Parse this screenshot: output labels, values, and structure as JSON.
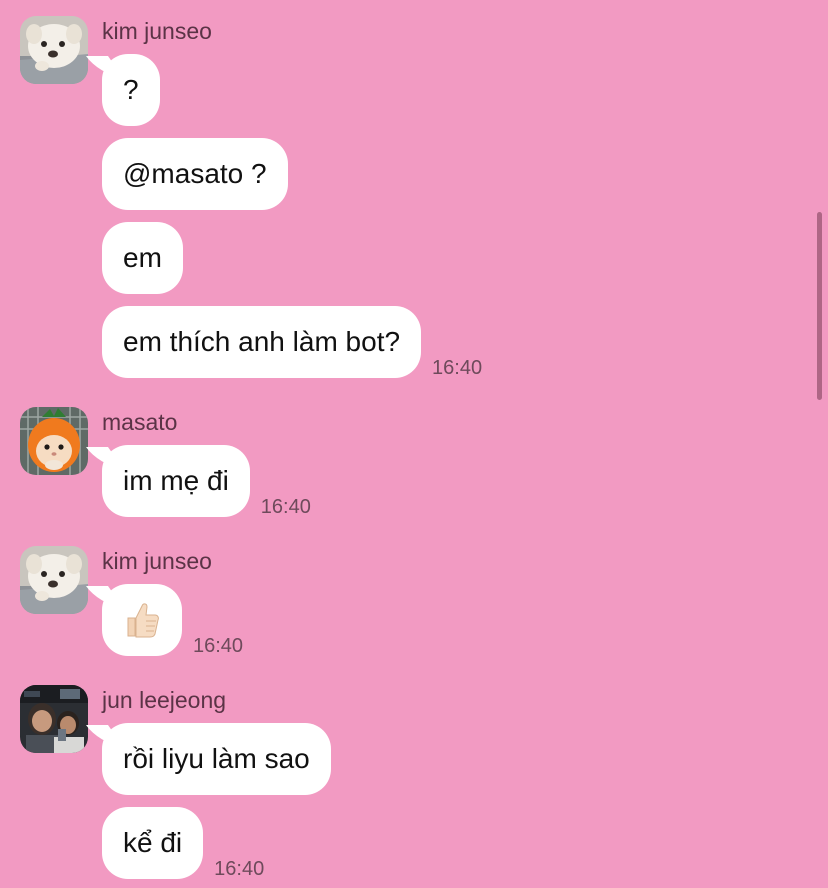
{
  "colors": {
    "background": "#f29ac2",
    "bubble": "#ffffff",
    "sender_name": "#5b3346",
    "timestamp": "#6e4a5b"
  },
  "groups": [
    {
      "sender": "kim junseo",
      "avatar_icon": "white-dog-avatar",
      "messages": [
        {
          "text": "?",
          "time": ""
        },
        {
          "text": "@masato ?",
          "time": ""
        },
        {
          "text": "em",
          "time": ""
        },
        {
          "text": "em thích anh làm bot?",
          "time": "16:40"
        }
      ]
    },
    {
      "sender": "masato",
      "avatar_icon": "hamster-in-carrot-costume-avatar",
      "messages": [
        {
          "text": "im mẹ đi",
          "time": "16:40"
        }
      ]
    },
    {
      "sender": "kim junseo",
      "avatar_icon": "white-dog-avatar",
      "messages": [
        {
          "text": "",
          "emoji": "thumbs-up-icon",
          "time": "16:40"
        }
      ]
    },
    {
      "sender": "jun leejeong",
      "avatar_icon": "person-photo-avatar",
      "messages": [
        {
          "text": "rồi liyu làm sao",
          "time": ""
        },
        {
          "text": "kể đi",
          "time": "16:40"
        }
      ]
    }
  ]
}
